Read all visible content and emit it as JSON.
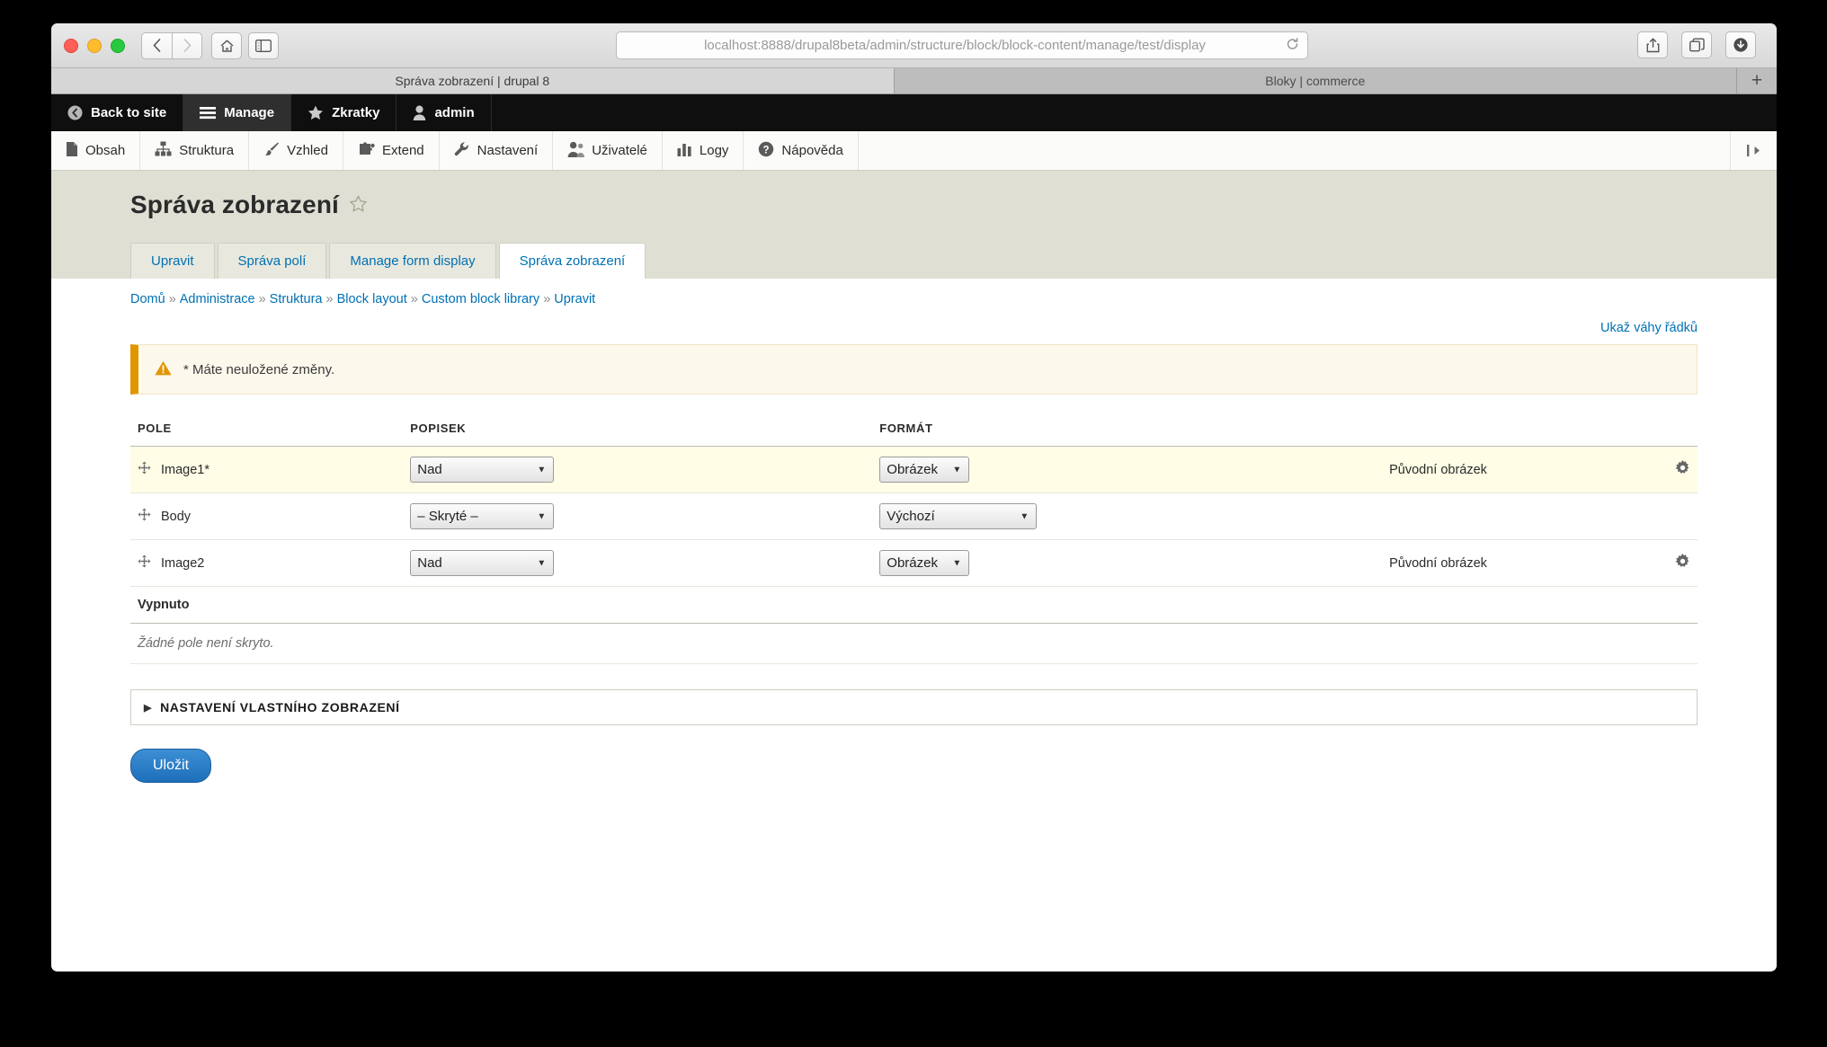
{
  "browser": {
    "url_host": "localhost:8888",
    "url_path": "/drupal8beta/admin/structure/block/block-content/manage/test/display",
    "nav": {
      "back": "back-arrow",
      "forward": "forward-arrow",
      "home": "home-icon",
      "sidebar": "sidebar-icon",
      "reload": "reload-icon",
      "share": "share-icon",
      "tabs": "tab-overview-icon",
      "downloads": "downloads-icon"
    },
    "tabs": [
      {
        "title": "Správa zobrazení | drupal 8",
        "active": true
      },
      {
        "title": "Bloky | commerce",
        "active": false
      }
    ],
    "new_tab_label": "+"
  },
  "admin_toolbar": {
    "items": [
      {
        "label": "Back to site",
        "icon": "back-circle-icon",
        "active": false
      },
      {
        "label": "Manage",
        "icon": "hamburger-icon",
        "active": true
      },
      {
        "label": "Zkratky",
        "icon": "star-icon",
        "active": false
      },
      {
        "label": "admin",
        "icon": "user-icon",
        "active": false
      }
    ]
  },
  "menu_bar": {
    "items": [
      {
        "label": "Obsah",
        "icon": "file-icon"
      },
      {
        "label": "Struktura",
        "icon": "sitemap-icon"
      },
      {
        "label": "Vzhled",
        "icon": "paintbrush-icon"
      },
      {
        "label": "Extend",
        "icon": "puzzle-icon"
      },
      {
        "label": "Nastavení",
        "icon": "wrench-icon"
      },
      {
        "label": "Uživatelé",
        "icon": "users-icon"
      },
      {
        "label": "Logy",
        "icon": "bar-chart-icon"
      },
      {
        "label": "Nápověda",
        "icon": "question-circle-icon"
      }
    ],
    "collapse_icon": "toolbar-collapse-icon"
  },
  "page": {
    "title": "Správa zobrazení",
    "bookmark_icon": "star-outline-icon",
    "tabs": [
      {
        "label": "Upravit",
        "active": false
      },
      {
        "label": "Správa polí",
        "active": false
      },
      {
        "label": "Manage form display",
        "active": false
      },
      {
        "label": "Správa zobrazení",
        "active": true
      }
    ],
    "breadcrumb": [
      "Domů",
      "Administrace",
      "Struktura",
      "Block layout",
      "Custom block library",
      "Upravit"
    ],
    "breadcrumb_separator": "»",
    "show_row_weights": "Ukaž váhy řádků",
    "warning": {
      "icon": "warning-triangle-icon",
      "text": "* Máte neuložené změny."
    },
    "table": {
      "headers": [
        "POLE",
        "POPISEK",
        "FORMÁT",
        "",
        ""
      ],
      "rows": [
        {
          "field": "Image1*",
          "label_select": "Nad",
          "format_select": "Obrázek",
          "summary": "Původní obrázek",
          "has_settings": true,
          "changed": true,
          "drag_icon": "drag-handle-icon",
          "gear_icon": "gear-icon"
        },
        {
          "field": "Body",
          "label_select": "– Skryté –",
          "format_select": "Výchozí",
          "summary": "",
          "has_settings": false,
          "changed": false,
          "drag_icon": "drag-handle-icon",
          "gear_icon": ""
        },
        {
          "field": "Image2",
          "label_select": "Nad",
          "format_select": "Obrázek",
          "summary": "Původní obrázek",
          "has_settings": true,
          "changed": false,
          "drag_icon": "drag-handle-icon",
          "gear_icon": "gear-icon"
        }
      ],
      "disabled_section_label": "Vypnuto",
      "disabled_empty_text": "Žádné pole není skryto."
    },
    "custom_display_settings": {
      "label": "NASTAVENÍ VLASTNÍHO ZOBRAZENÍ",
      "toggle_icon": "triangle-right-icon",
      "expanded": false
    },
    "save_button": "Uložit"
  },
  "colors": {
    "link": "#0071b3",
    "warning": "#e09600",
    "changed_row": "#fffde6",
    "primary_button": "#1e6fba"
  }
}
